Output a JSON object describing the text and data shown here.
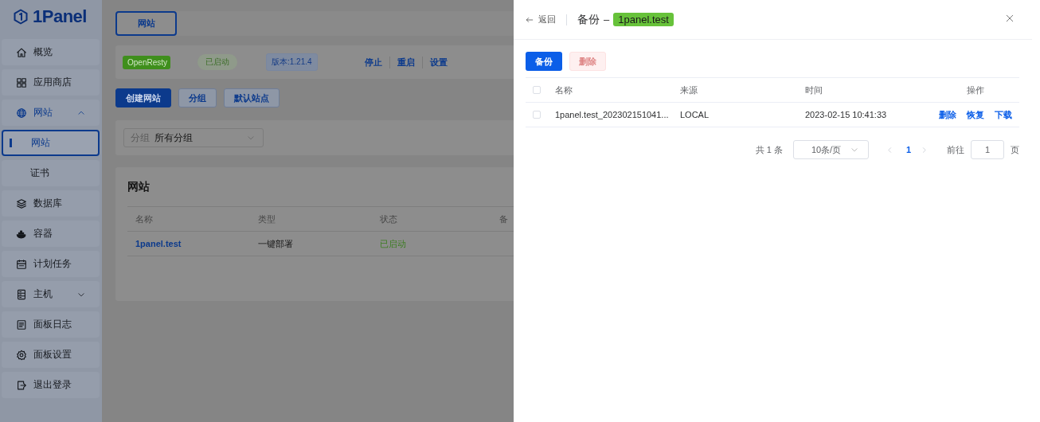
{
  "sidebar": {
    "logo": "1Panel",
    "items": [
      {
        "label": "概览",
        "selected": false
      },
      {
        "label": "应用商店",
        "selected": false
      },
      {
        "label": "网站",
        "selected": false,
        "expanded": true,
        "children": [
          {
            "label": "网站",
            "selected": true
          },
          {
            "label": "证书",
            "selected": false
          }
        ]
      },
      {
        "label": "数据库",
        "selected": false
      },
      {
        "label": "容器",
        "selected": false
      },
      {
        "label": "计划任务",
        "selected": false
      },
      {
        "label": "主机",
        "selected": false,
        "expanded": false
      },
      {
        "label": "面板日志",
        "selected": false
      },
      {
        "label": "面板设置",
        "selected": false
      },
      {
        "label": "退出登录",
        "selected": false
      }
    ]
  },
  "page_tab": {
    "label": "网站",
    "selected": true
  },
  "app_bar": {
    "app": "OpenResty",
    "status": "已启动",
    "version": "版本:1.21.4",
    "actions": [
      "停止",
      "重启",
      "设置"
    ]
  },
  "toolbar": {
    "buttons": [
      {
        "label": "创建网站",
        "kind": "primary"
      },
      {
        "label": "分组",
        "kind": "plain"
      },
      {
        "label": "默认站点",
        "kind": "plain"
      }
    ]
  },
  "filter": {
    "label": "分组",
    "value": "所有分组"
  },
  "websites": {
    "title": "网站",
    "columns": [
      "名称",
      "类型",
      "状态",
      "备"
    ],
    "rows": [
      {
        "name": "1panel.test",
        "type": "一键部署",
        "status": "已启动"
      }
    ]
  },
  "drawer": {
    "back": "返回",
    "title": "备份",
    "dash": "–",
    "subject": "1panel.test",
    "buttons": [
      {
        "label": "备份",
        "kind": "primary",
        "disabled": false
      },
      {
        "label": "删除",
        "kind": "danger",
        "disabled": true
      }
    ],
    "table": {
      "all_checked": false,
      "columns": [
        "名称",
        "来源",
        "时间",
        "操作"
      ],
      "rows": [
        {
          "checked": false,
          "name": "1panel.test_202302151041...",
          "source": "LOCAL",
          "time": "2023-02-15 10:41:33",
          "actions": [
            "删除",
            "恢复",
            "下载"
          ]
        }
      ]
    },
    "pagination": {
      "total": "共 1 条",
      "page_size": "10条/页",
      "pages": [
        {
          "label": "1",
          "selected": true
        }
      ],
      "goto_label": "前往",
      "goto_value": "1",
      "goto_suffix": "页"
    }
  }
}
